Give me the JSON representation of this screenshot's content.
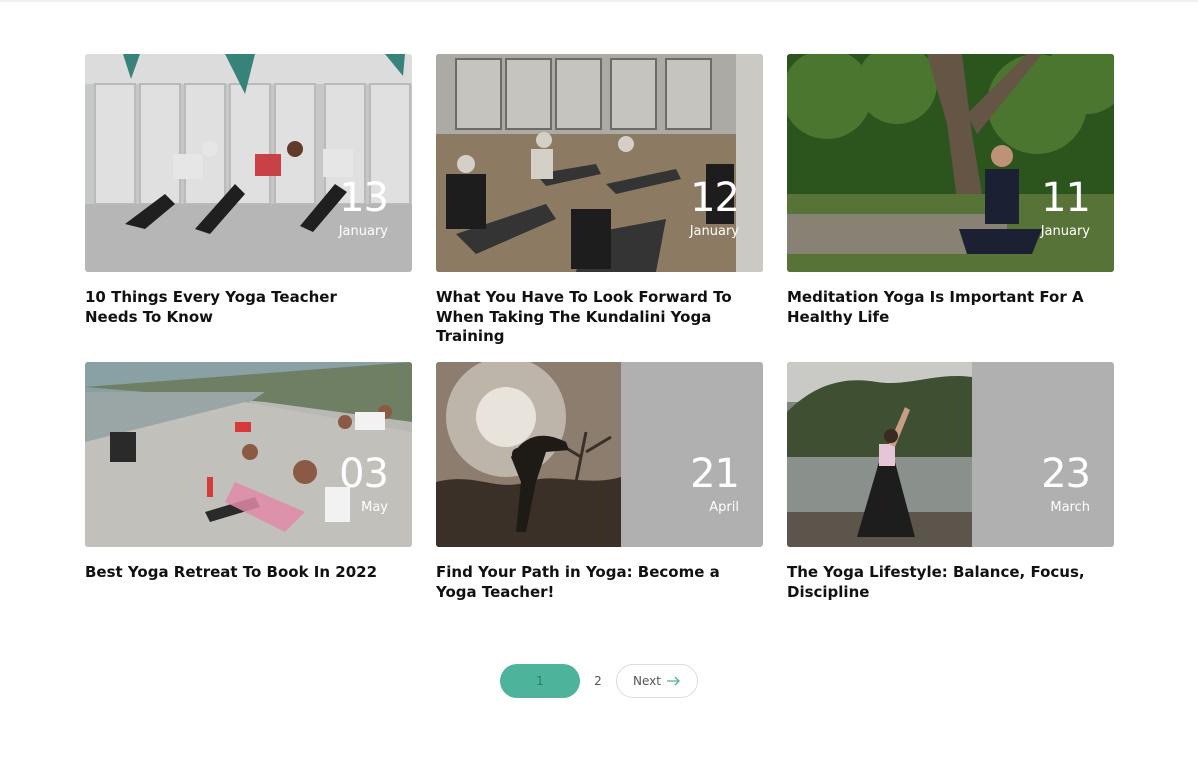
{
  "posts": [
    {
      "day": "13",
      "month": "January",
      "title": "10 Things Every Yoga Teacher Needs To Know"
    },
    {
      "day": "12",
      "month": "January",
      "title": "What You Have To Look Forward To When Taking The Kundalini Yoga Training"
    },
    {
      "day": "11",
      "month": "January",
      "title": "Meditation Yoga Is Important For A Healthy Life"
    },
    {
      "day": "03",
      "month": "May",
      "title": "Best Yoga Retreat To Book In 2022"
    },
    {
      "day": "21",
      "month": "April",
      "title": "Find Your Path in Yoga: Become a Yoga Teacher!"
    },
    {
      "day": "23",
      "month": "March",
      "title": "The Yoga Lifestyle: Balance, Focus, Discipline"
    }
  ],
  "pagination": {
    "current": "1",
    "page2": "2",
    "next_label": "Next",
    "next_icon": "arrow-right-icon"
  },
  "colors": {
    "accent": "#4db39a",
    "date_panel": "#b0b0b0"
  }
}
